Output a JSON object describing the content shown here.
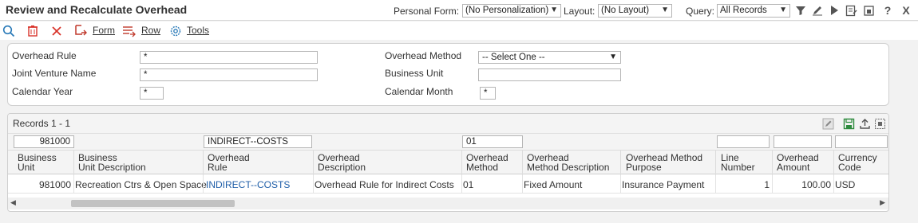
{
  "header": {
    "title": "Review and Recalculate Overhead",
    "personal_form_label": "Personal Form:",
    "personal_form_value": "(No Personalization)",
    "layout_label": "Layout:",
    "layout_value": "(No Layout)",
    "query_label": "Query:",
    "query_value": "All Records",
    "help_glyph": "?",
    "close_glyph": "X"
  },
  "toolbar": {
    "form_label": "Form",
    "row_label": "Row",
    "tools_label": "Tools"
  },
  "filters": {
    "overhead_rule_label": "Overhead Rule",
    "overhead_rule_value": "*",
    "joint_venture_label": "Joint Venture Name",
    "joint_venture_value": "*",
    "calendar_year_label": "Calendar Year",
    "calendar_year_value": "*",
    "overhead_method_label": "Overhead Method",
    "overhead_method_value": "-- Select One --",
    "business_unit_label": "Business Unit",
    "business_unit_value": "",
    "calendar_month_label": "Calendar Month",
    "calendar_month_value": "*"
  },
  "grid": {
    "records_label": "Records 1 - 1",
    "qbe": {
      "business_unit": "981000",
      "business_unit_description": "",
      "overhead_rule": "INDIRECT--COSTS",
      "overhead_description": "",
      "overhead_method": "01",
      "overhead_method_description": "",
      "overhead_method_purpose": "",
      "line_number": "",
      "overhead_amount": "",
      "currency_code": ""
    },
    "columns": [
      {
        "line1": "Business",
        "line2": "Unit"
      },
      {
        "line1": "Business",
        "line2": "Unit Description"
      },
      {
        "line1": "Overhead",
        "line2": "Rule"
      },
      {
        "line1": "Overhead",
        "line2": "Description"
      },
      {
        "line1": "Overhead",
        "line2": "Method"
      },
      {
        "line1": "Overhead",
        "line2": "Method Description"
      },
      {
        "line1": "Overhead Method",
        "line2": "Purpose"
      },
      {
        "line1": "Line",
        "line2": "Number"
      },
      {
        "line1": "Overhead",
        "line2": "Amount"
      },
      {
        "line1": "Currency",
        "line2": "Code"
      }
    ],
    "rows": [
      {
        "business_unit": "981000",
        "business_unit_description": "Recreation Ctrs & Open Space",
        "overhead_rule": "INDIRECT--COSTS",
        "overhead_description": "Overhead Rule for Indirect Costs",
        "overhead_method": "01",
        "overhead_method_description": "Fixed Amount",
        "overhead_method_purpose": "Insurance Payment",
        "line_number": "1",
        "overhead_amount": "100.00",
        "currency_code": "USD"
      }
    ]
  },
  "colors": {
    "link": "#1f5ea8",
    "delete_red": "#d9342b",
    "form_icon": "#c0392b",
    "tools_icon": "#2a7ab8",
    "save_green": "#2e8b3e"
  }
}
